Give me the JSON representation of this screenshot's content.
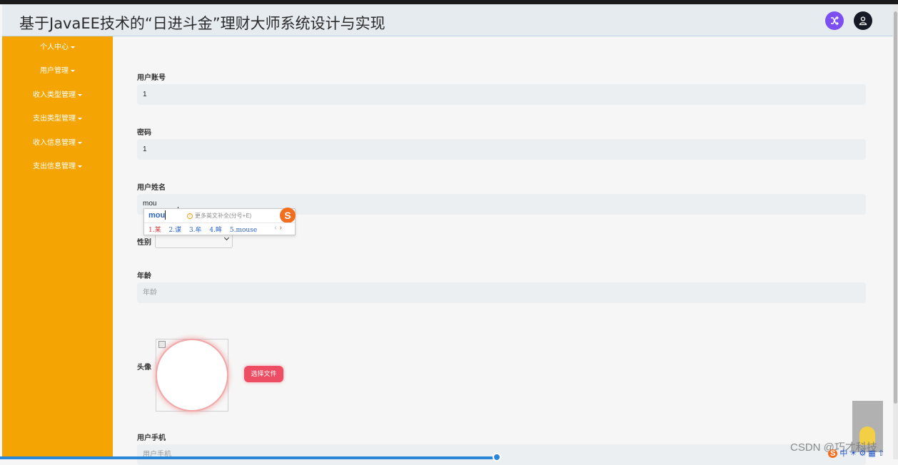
{
  "header": {
    "title": "基于JavaEE技术的“日进斗金”理财大师系统设计与实现"
  },
  "sidebar": {
    "items": [
      {
        "label": "个人中心"
      },
      {
        "label": "用户管理"
      },
      {
        "label": "收入类型管理"
      },
      {
        "label": "支出类型管理"
      },
      {
        "label": "收入信息管理"
      },
      {
        "label": "支出信息管理"
      }
    ]
  },
  "form": {
    "account": {
      "label": "用户账号",
      "value": "1"
    },
    "password": {
      "label": "密码",
      "value": "1"
    },
    "name": {
      "label": "用户姓名",
      "value": "mou"
    },
    "gender": {
      "label": "性别",
      "value": ""
    },
    "age": {
      "label": "年龄",
      "placeholder": "年龄"
    },
    "avatar": {
      "label": "头像",
      "button": "选择文件"
    },
    "phone": {
      "label": "用户手机",
      "placeholder": "用户手机"
    }
  },
  "ime": {
    "composition": "mou",
    "hint": "更多英文补全(分号+E)",
    "candidates": [
      "1.某",
      "2.谋",
      "3.牟",
      "4.眸",
      "5.mouse"
    ],
    "logo": "S"
  },
  "watermark": "CSDN @巧才科技",
  "colors": {
    "sidebar": "#f5a503",
    "accent": "#ee4e63",
    "shuffle_button": "#7c4ff0"
  }
}
